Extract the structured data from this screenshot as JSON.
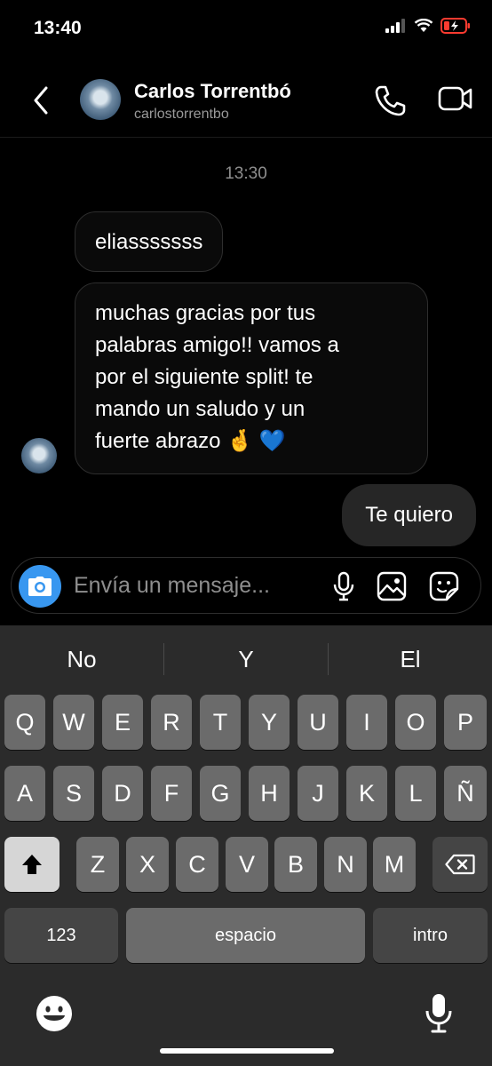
{
  "status": {
    "time": "13:40"
  },
  "header": {
    "name": "Carlos Torrentbó",
    "username": "carlostorrentbo"
  },
  "chat": {
    "timestamp": "13:30",
    "incoming": [
      {
        "text": "eliasssssss"
      },
      {
        "text": "muchas gracias por tus\npalabras amigo!! vamos a\npor el siguiente split! te\nmando un saludo y un\nfuerte abrazo 🤞 💙"
      }
    ],
    "outgoing": [
      {
        "text": "Te quiero"
      }
    ]
  },
  "composer": {
    "placeholder": "Envía un mensaje..."
  },
  "keyboard": {
    "suggestions": [
      "No",
      "Y",
      "El"
    ],
    "row1": [
      "Q",
      "W",
      "E",
      "R",
      "T",
      "Y",
      "U",
      "I",
      "O",
      "P"
    ],
    "row2": [
      "A",
      "S",
      "D",
      "F",
      "G",
      "H",
      "J",
      "K",
      "L",
      "Ñ"
    ],
    "row3": [
      "Z",
      "X",
      "C",
      "V",
      "B",
      "N",
      "M"
    ],
    "numbers_label": "123",
    "space_label": "espacio",
    "return_label": "intro"
  },
  "colors": {
    "accent": "#3897f0",
    "battery_low": "#ff3b30"
  }
}
